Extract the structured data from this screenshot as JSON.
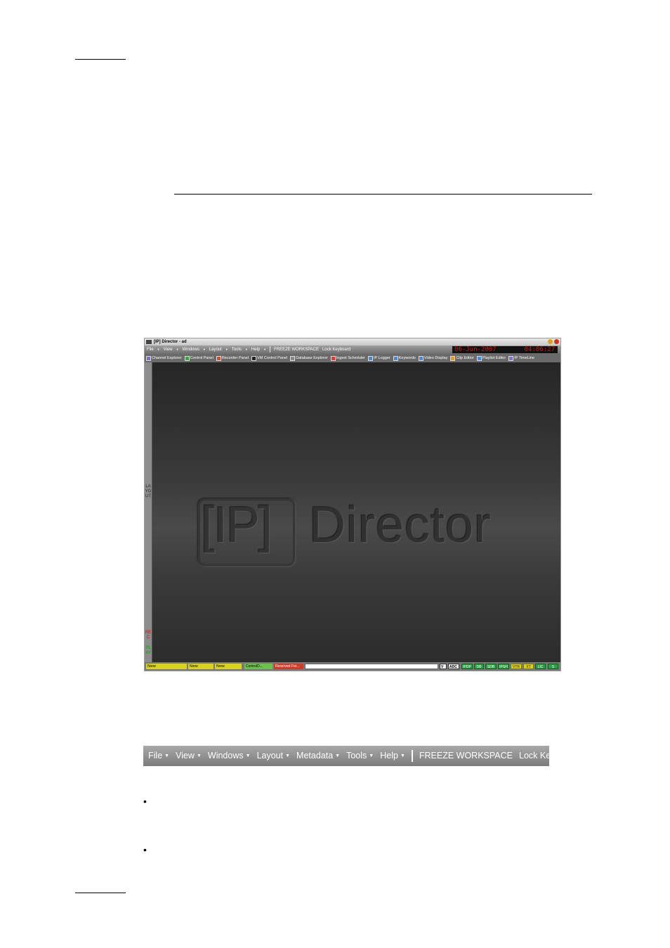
{
  "app": {
    "window_title": "[IP] Director - ad",
    "menu": [
      "File",
      "View",
      "Windows",
      "Layout",
      "Tools",
      "Help"
    ],
    "actions": [
      "FREEZE WORKSPACE",
      "Lock Keyboard"
    ],
    "date": "06-Jun-2007",
    "time": "04:06:27",
    "toolbar": [
      {
        "label": "Channel Explorer",
        "icon": "channel-icon",
        "color": "#7b6fd0"
      },
      {
        "label": "Control Panel",
        "icon": "control-panel-icon",
        "color": "#3aa34a"
      },
      {
        "label": "Recorder Panel",
        "icon": "recorder-icon",
        "color": "#d84a2a"
      },
      {
        "label": "VM Control Panel",
        "icon": "vm-icon",
        "color": "#222222"
      },
      {
        "label": "Database Explorer",
        "icon": "database-icon",
        "color": "#888888"
      },
      {
        "label": "Ingest Scheduler",
        "icon": "scheduler-icon",
        "color": "#d63a3a"
      },
      {
        "label": "IP Logger",
        "icon": "logger-icon",
        "color": "#4a8ad8"
      },
      {
        "label": "Keywords",
        "icon": "keywords-icon",
        "color": "#4a8ad8"
      },
      {
        "label": "Video Display",
        "icon": "video-display-icon",
        "color": "#4a8ad8"
      },
      {
        "label": "Clip Editor",
        "icon": "clip-editor-icon",
        "color": "#e09a2a"
      },
      {
        "label": "Playlist Editor",
        "icon": "playlist-icon",
        "color": "#4a8ad8"
      },
      {
        "label": "IP TimeLine",
        "icon": "timeline-icon",
        "color": "#7b6fd0"
      }
    ],
    "sidebar": {
      "layout": "LAYOUT",
      "rec": "REC",
      "play": "PLAY"
    },
    "logo": {
      "ip": "[IP]",
      "director": "Director"
    },
    "status": {
      "chips": [
        {
          "label": "None",
          "kind": "y"
        },
        {
          "label": "None",
          "kind": "y"
        },
        {
          "label": "None",
          "kind": "y"
        },
        {
          "label": "ControlD...",
          "kind": "g"
        },
        {
          "label": "Reserved For...",
          "kind": "r"
        }
      ],
      "v_label": "V",
      "adc_label": "ADC",
      "indicators": [
        {
          "label": "IPDP",
          "kind": "g"
        },
        {
          "label": "DB",
          "kind": "g"
        },
        {
          "label": "SDB",
          "kind": "g"
        },
        {
          "label": "IPSH",
          "kind": "g"
        },
        {
          "label": "VTR",
          "kind": "yel"
        },
        {
          "label": "XT",
          "kind": "yel"
        },
        {
          "label": "LIC",
          "kind": "g"
        },
        {
          "label": "S",
          "kind": "g"
        }
      ]
    }
  },
  "menubar": {
    "items": [
      "File",
      "View",
      "Windows",
      "Layout",
      "Metadata",
      "Tools",
      "Help"
    ],
    "actions": [
      "FREEZE WORKSPACE",
      "Lock Keyboard"
    ]
  },
  "bullets": [
    "•",
    "•"
  ]
}
